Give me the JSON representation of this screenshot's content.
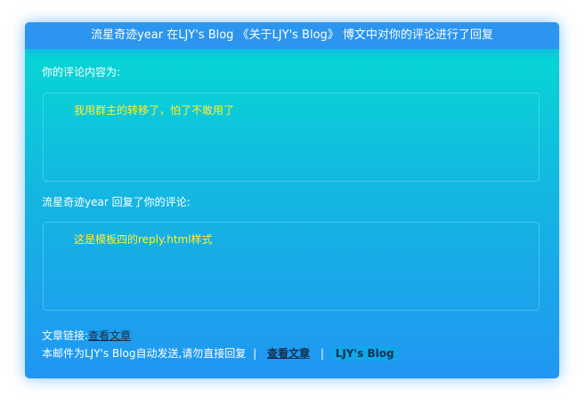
{
  "header": {
    "title": "流星奇迹year 在LJY's Blog 《关于LJY's Blog》 博文中对你的评论进行了回复"
  },
  "comment_section": {
    "label": "你的评论内容为:",
    "content": "我用群主的转移了，怕了不敢用了"
  },
  "reply_section": {
    "label": "流星奇迹year 回复了你的评论:",
    "content": "这是模板四的reply.html样式"
  },
  "footer": {
    "article_link_label": "文章链接:",
    "article_link_text": "查看文章",
    "notice": "本邮件为LJY's Blog自动发送,请勿直接回复",
    "sep1": "|",
    "view_article": "查看文章",
    "sep2": "|",
    "blog_name": "LJY's Blog"
  },
  "colors": {
    "header_bg": "#2c95ef",
    "gradient_top": "#05dcd2",
    "gradient_bottom": "#2196f3",
    "content_text": "#fff22a"
  }
}
